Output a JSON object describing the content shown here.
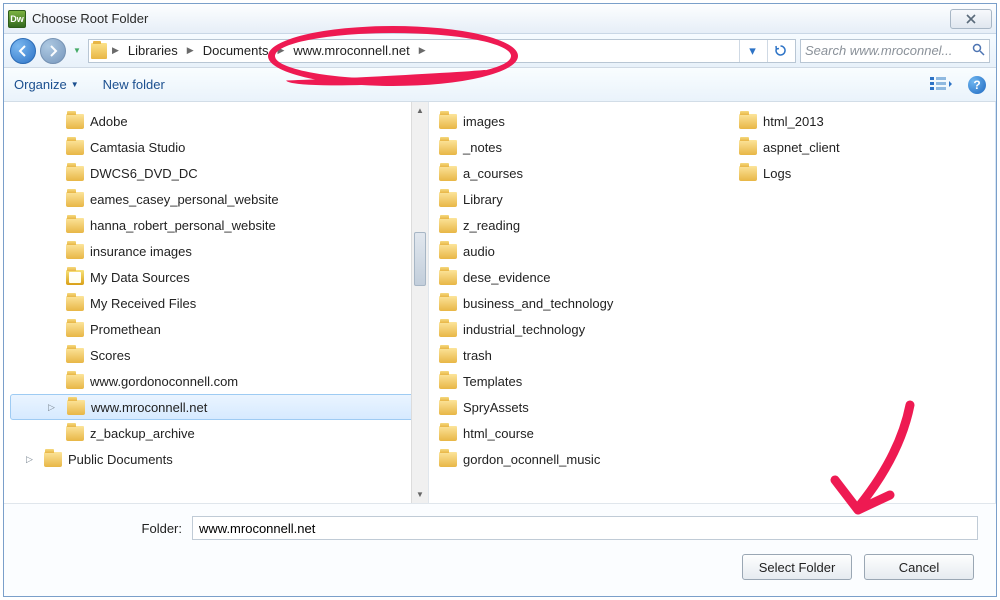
{
  "window": {
    "title": "Choose Root Folder",
    "app_badge": "Dw"
  },
  "nav": {
    "breadcrumb": [
      "Libraries",
      "Documents",
      "www.mroconnell.net"
    ],
    "search_placeholder": "Search www.mroconnel..."
  },
  "toolbar": {
    "organize": "Organize",
    "new_folder": "New folder"
  },
  "tree": {
    "items": [
      {
        "label": "Adobe"
      },
      {
        "label": "Camtasia Studio"
      },
      {
        "label": "DWCS6_DVD_DC"
      },
      {
        "label": "eames_casey_personal_website"
      },
      {
        "label": "hanna_robert_personal_website"
      },
      {
        "label": "insurance images"
      },
      {
        "label": "My Data Sources",
        "icon": "db"
      },
      {
        "label": "My Received Files"
      },
      {
        "label": "Promethean"
      },
      {
        "label": "Scores"
      },
      {
        "label": "www.gordonoconnell.com"
      },
      {
        "label": "www.mroconnell.net",
        "selected": true,
        "expandable": true
      },
      {
        "label": "z_backup_archive"
      }
    ],
    "public": "Public Documents"
  },
  "content": {
    "col1": [
      "images",
      "_notes",
      "a_courses",
      "Library",
      "z_reading",
      "audio",
      "dese_evidence",
      "business_and_technology",
      "industrial_technology",
      "trash",
      "Templates",
      "SpryAssets",
      "html_course",
      "gordon_oconnell_music"
    ],
    "col2": [
      "html_2013",
      "aspnet_client",
      "Logs"
    ]
  },
  "footer": {
    "folder_label": "Folder:",
    "folder_value": "www.mroconnell.net",
    "select": "Select Folder",
    "cancel": "Cancel"
  }
}
